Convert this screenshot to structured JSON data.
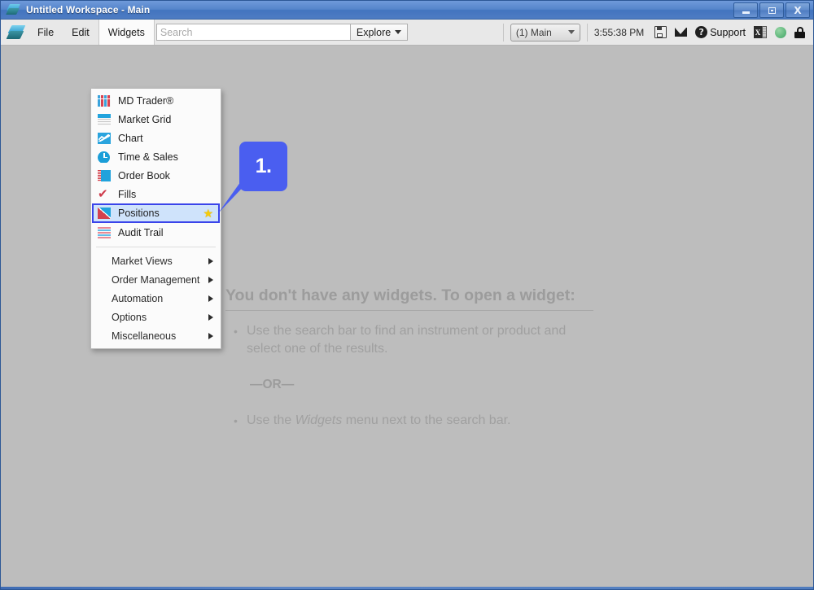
{
  "window": {
    "title": "Untitled Workspace - Main",
    "logo_icon": "tt-diamond-logo-icon",
    "controls": {
      "minimize": "minimize-icon",
      "restore": "restore-icon",
      "close": "X"
    }
  },
  "toolbar": {
    "logo_icon": "tt-diamond-logo-icon",
    "menus": [
      {
        "label": "File",
        "active": false
      },
      {
        "label": "Edit",
        "active": false
      },
      {
        "label": "Widgets",
        "active": true
      }
    ],
    "search": {
      "placeholder": "Search",
      "value": ""
    },
    "explore_label": "Explore",
    "workspace_selector": "(1) Main",
    "clock": "3:55:38 PM",
    "support_label": "Support",
    "right_icons": [
      "save-icon",
      "mail-icon",
      "help-icon",
      "excel-export-icon",
      "connection-status-icon",
      "lock-icon"
    ],
    "excel_glyph": "X"
  },
  "widgets_menu": {
    "items": [
      {
        "label": "MD Trader®",
        "icon": "md-trader-icon",
        "selected": false,
        "favorite": false
      },
      {
        "label": "Market Grid",
        "icon": "market-grid-icon",
        "selected": false,
        "favorite": false
      },
      {
        "label": "Chart",
        "icon": "chart-icon",
        "selected": false,
        "favorite": false
      },
      {
        "label": "Time & Sales",
        "icon": "time-and-sales-icon",
        "selected": false,
        "favorite": false
      },
      {
        "label": "Order Book",
        "icon": "order-book-icon",
        "selected": false,
        "favorite": false
      },
      {
        "label": "Fills",
        "icon": "fills-icon",
        "selected": false,
        "favorite": false
      },
      {
        "label": "Positions",
        "icon": "positions-icon",
        "selected": true,
        "favorite": true
      },
      {
        "label": "Audit Trail",
        "icon": "audit-trail-icon",
        "selected": false,
        "favorite": false
      }
    ],
    "submenus": [
      {
        "label": "Market Views"
      },
      {
        "label": "Order Management"
      },
      {
        "label": "Automation"
      },
      {
        "label": "Options"
      },
      {
        "label": "Miscellaneous"
      }
    ],
    "favorite_star": "★"
  },
  "callout": {
    "number": "1.",
    "color": "#4a5ef0"
  },
  "empty_state": {
    "title": "You don't have any widgets. To open a widget:",
    "bullet_1": "Use the search bar to find an instrument or product and select one of the results.",
    "or_text": "—OR—",
    "bullet_2_prefix": "Use the ",
    "bullet_2_emphasis": "Widgets",
    "bullet_2_suffix": " menu next to the search bar."
  },
  "colors": {
    "titlebar_blue": "#5585cb",
    "workspace_gray": "#bdbdbd",
    "selection_blue": "#3a44ea",
    "selection_fill": "#cfe3fb",
    "star_yellow": "#f5cb0a",
    "callout_blue": "#4a5ef0",
    "accent_cyan": "#20a2dc",
    "accent_red": "#d4404f"
  }
}
